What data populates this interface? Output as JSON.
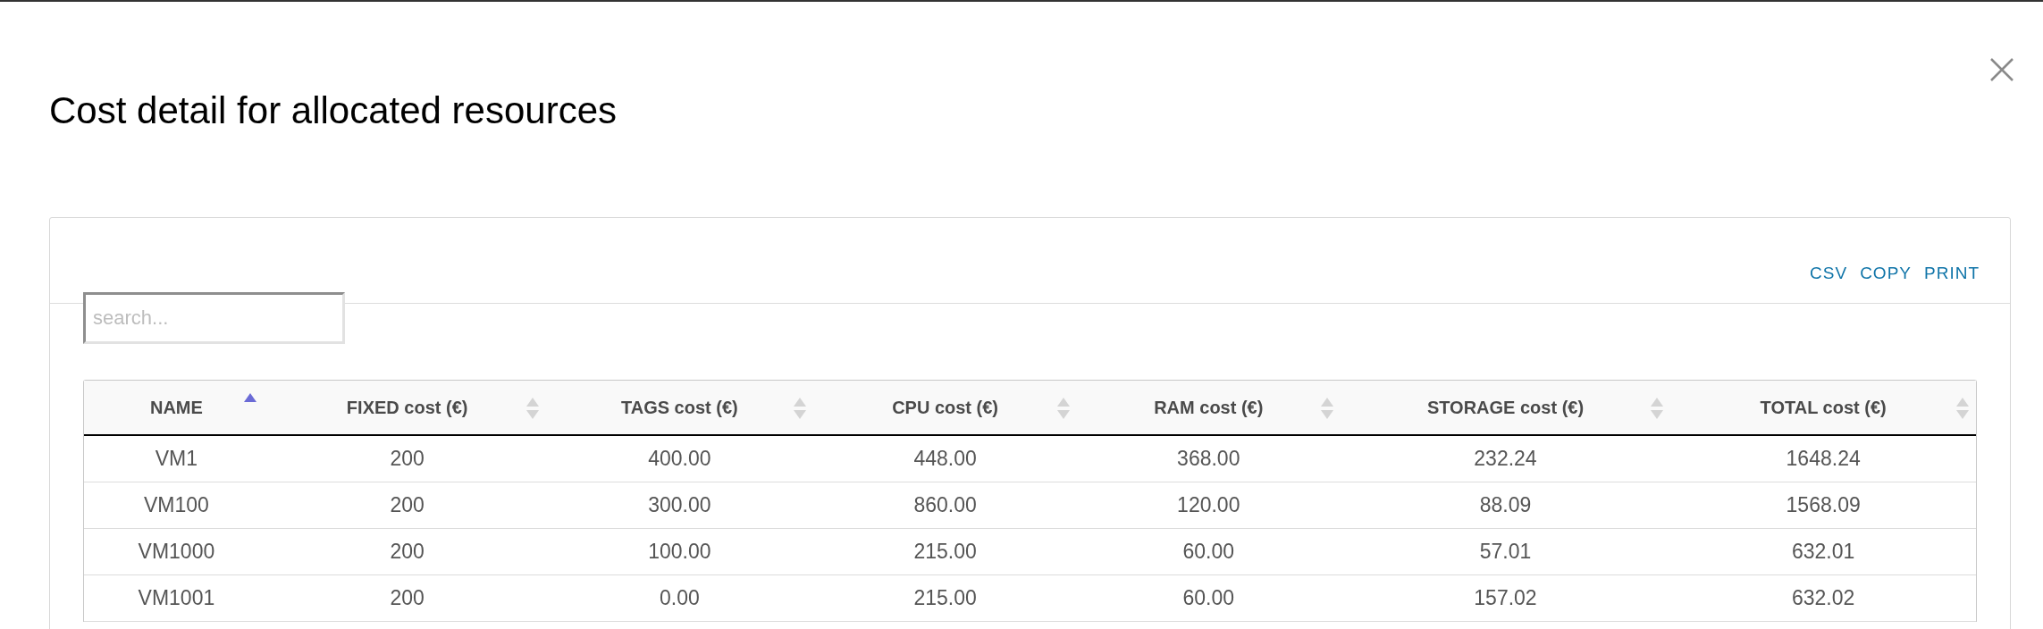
{
  "dialog": {
    "title": "Cost detail for allocated resources"
  },
  "export_links": [
    "CSV",
    "COPY",
    "PRINT"
  ],
  "search": {
    "placeholder": "search..."
  },
  "table": {
    "columns": [
      {
        "label": "NAME",
        "sorted_ascending": true
      },
      {
        "label": "FIXED cost (€)",
        "sorted_ascending": false
      },
      {
        "label": "TAGS cost (€)",
        "sorted_ascending": false
      },
      {
        "label": "CPU cost (€)",
        "sorted_ascending": false
      },
      {
        "label": "RAM cost (€)",
        "sorted_ascending": false
      },
      {
        "label": "STORAGE cost (€)",
        "sorted_ascending": false
      },
      {
        "label": "TOTAL cost (€)",
        "sorted_ascending": false
      }
    ],
    "rows": [
      [
        "VM1",
        "200",
        "400.00",
        "448.00",
        "368.00",
        "232.24",
        "1648.24"
      ],
      [
        "VM100",
        "200",
        "300.00",
        "860.00",
        "120.00",
        "88.09",
        "1568.09"
      ],
      [
        "VM1000",
        "200",
        "100.00",
        "215.00",
        "60.00",
        "57.01",
        "632.01"
      ],
      [
        "VM1001",
        "200",
        "0.00",
        "215.00",
        "60.00",
        "157.02",
        "632.02"
      ]
    ]
  }
}
